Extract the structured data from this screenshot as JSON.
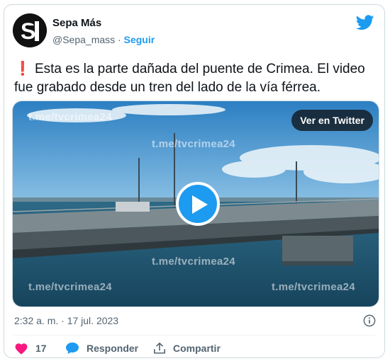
{
  "author": {
    "name": "Sepa Más",
    "handle": "@Sepa_mass",
    "separator": "·",
    "follow_label": "Seguir",
    "avatar_text": "S"
  },
  "tweet": {
    "emoji": "❗",
    "text": "Esta es la parte dañada del puente de Crimea. El video fue grabado desde un tren del lado de la vía férrea."
  },
  "media": {
    "watermark": "t.me/tvcrimea24",
    "view_button": "Ver en Twitter",
    "play_icon": "play-icon"
  },
  "meta": {
    "timestamp": "2:32 a. m. · 17 jul. 2023",
    "info_icon": "info-icon"
  },
  "actions": {
    "likes": "17",
    "reply_label": "Responder",
    "share_label": "Compartir"
  },
  "colors": {
    "accent": "#1d9bf0",
    "like": "#f91880",
    "text_secondary": "#536471"
  }
}
